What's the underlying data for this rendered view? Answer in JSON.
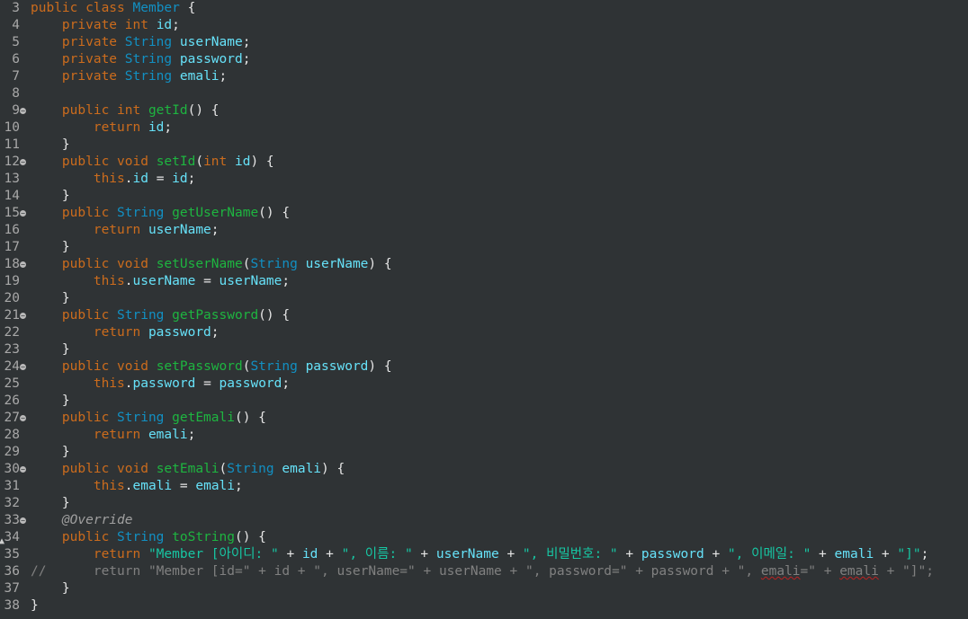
{
  "editor": {
    "lines": [
      {
        "n": "3",
        "fold": false,
        "toks": [
          [
            "kw",
            "public "
          ],
          [
            "kw",
            "class "
          ],
          [
            "type",
            "Member "
          ],
          [
            "txt",
            "{"
          ]
        ]
      },
      {
        "n": "4",
        "fold": false,
        "toks": [
          [
            "txt",
            "    "
          ],
          [
            "kw",
            "private "
          ],
          [
            "kw",
            "int "
          ],
          [
            "fld",
            "id"
          ],
          [
            "txt",
            ";"
          ]
        ]
      },
      {
        "n": "5",
        "fold": false,
        "toks": [
          [
            "txt",
            "    "
          ],
          [
            "kw",
            "private "
          ],
          [
            "type",
            "String "
          ],
          [
            "fld",
            "userName"
          ],
          [
            "txt",
            ";"
          ]
        ]
      },
      {
        "n": "6",
        "fold": false,
        "toks": [
          [
            "txt",
            "    "
          ],
          [
            "kw",
            "private "
          ],
          [
            "type",
            "String "
          ],
          [
            "fld",
            "password"
          ],
          [
            "txt",
            ";"
          ]
        ]
      },
      {
        "n": "7",
        "fold": false,
        "toks": [
          [
            "txt",
            "    "
          ],
          [
            "kw",
            "private "
          ],
          [
            "type",
            "String "
          ],
          [
            "fld",
            "emali"
          ],
          [
            "txt",
            ";"
          ]
        ]
      },
      {
        "n": "8",
        "fold": false,
        "toks": []
      },
      {
        "n": "9",
        "fold": true,
        "toks": [
          [
            "txt",
            "    "
          ],
          [
            "kw",
            "public "
          ],
          [
            "kw",
            "int "
          ],
          [
            "meth",
            "getId"
          ],
          [
            "txt",
            "() {"
          ]
        ]
      },
      {
        "n": "10",
        "fold": false,
        "toks": [
          [
            "txt",
            "        "
          ],
          [
            "kw",
            "return "
          ],
          [
            "fld",
            "id"
          ],
          [
            "txt",
            ";"
          ]
        ]
      },
      {
        "n": "11",
        "fold": false,
        "toks": [
          [
            "txt",
            "    }"
          ]
        ]
      },
      {
        "n": "12",
        "fold": true,
        "toks": [
          [
            "txt",
            "    "
          ],
          [
            "kw",
            "public "
          ],
          [
            "kw",
            "void "
          ],
          [
            "meth",
            "setId"
          ],
          [
            "txt",
            "("
          ],
          [
            "kw",
            "int "
          ],
          [
            "fld",
            "id"
          ],
          [
            "txt",
            ") {"
          ]
        ]
      },
      {
        "n": "13",
        "fold": false,
        "toks": [
          [
            "txt",
            "        "
          ],
          [
            "kw",
            "this"
          ],
          [
            "txt",
            "."
          ],
          [
            "fld",
            "id"
          ],
          [
            "txt",
            " = "
          ],
          [
            "fld",
            "id"
          ],
          [
            "txt",
            ";"
          ]
        ]
      },
      {
        "n": "14",
        "fold": false,
        "toks": [
          [
            "txt",
            "    }"
          ]
        ]
      },
      {
        "n": "15",
        "fold": true,
        "toks": [
          [
            "txt",
            "    "
          ],
          [
            "kw",
            "public "
          ],
          [
            "type",
            "String "
          ],
          [
            "meth",
            "getUserName"
          ],
          [
            "txt",
            "() {"
          ]
        ]
      },
      {
        "n": "16",
        "fold": false,
        "toks": [
          [
            "txt",
            "        "
          ],
          [
            "kw",
            "return "
          ],
          [
            "fld",
            "userName"
          ],
          [
            "txt",
            ";"
          ]
        ]
      },
      {
        "n": "17",
        "fold": false,
        "toks": [
          [
            "txt",
            "    }"
          ]
        ]
      },
      {
        "n": "18",
        "fold": true,
        "toks": [
          [
            "txt",
            "    "
          ],
          [
            "kw",
            "public "
          ],
          [
            "kw",
            "void "
          ],
          [
            "meth",
            "setUserName"
          ],
          [
            "txt",
            "("
          ],
          [
            "type",
            "String "
          ],
          [
            "fld",
            "userName"
          ],
          [
            "txt",
            ") {"
          ]
        ]
      },
      {
        "n": "19",
        "fold": false,
        "toks": [
          [
            "txt",
            "        "
          ],
          [
            "kw",
            "this"
          ],
          [
            "txt",
            "."
          ],
          [
            "fld",
            "userName"
          ],
          [
            "txt",
            " = "
          ],
          [
            "fld",
            "userName"
          ],
          [
            "txt",
            ";"
          ]
        ]
      },
      {
        "n": "20",
        "fold": false,
        "toks": [
          [
            "txt",
            "    }"
          ]
        ]
      },
      {
        "n": "21",
        "fold": true,
        "toks": [
          [
            "txt",
            "    "
          ],
          [
            "kw",
            "public "
          ],
          [
            "type",
            "String "
          ],
          [
            "meth",
            "getPassword"
          ],
          [
            "txt",
            "() {"
          ]
        ]
      },
      {
        "n": "22",
        "fold": false,
        "toks": [
          [
            "txt",
            "        "
          ],
          [
            "kw",
            "return "
          ],
          [
            "fld",
            "password"
          ],
          [
            "txt",
            ";"
          ]
        ]
      },
      {
        "n": "23",
        "fold": false,
        "toks": [
          [
            "txt",
            "    }"
          ]
        ]
      },
      {
        "n": "24",
        "fold": true,
        "toks": [
          [
            "txt",
            "    "
          ],
          [
            "kw",
            "public "
          ],
          [
            "kw",
            "void "
          ],
          [
            "meth",
            "setPassword"
          ],
          [
            "txt",
            "("
          ],
          [
            "type",
            "String "
          ],
          [
            "fld",
            "password"
          ],
          [
            "txt",
            ") {"
          ]
        ]
      },
      {
        "n": "25",
        "fold": false,
        "toks": [
          [
            "txt",
            "        "
          ],
          [
            "kw",
            "this"
          ],
          [
            "txt",
            "."
          ],
          [
            "fld",
            "password"
          ],
          [
            "txt",
            " = "
          ],
          [
            "fld",
            "password"
          ],
          [
            "txt",
            ";"
          ]
        ]
      },
      {
        "n": "26",
        "fold": false,
        "toks": [
          [
            "txt",
            "    }"
          ]
        ]
      },
      {
        "n": "27",
        "fold": true,
        "toks": [
          [
            "txt",
            "    "
          ],
          [
            "kw",
            "public "
          ],
          [
            "type",
            "String "
          ],
          [
            "meth",
            "getEmali"
          ],
          [
            "txt",
            "() {"
          ]
        ]
      },
      {
        "n": "28",
        "fold": false,
        "toks": [
          [
            "txt",
            "        "
          ],
          [
            "kw",
            "return "
          ],
          [
            "fld",
            "emali"
          ],
          [
            "txt",
            ";"
          ]
        ]
      },
      {
        "n": "29",
        "fold": false,
        "toks": [
          [
            "txt",
            "    }"
          ]
        ]
      },
      {
        "n": "30",
        "fold": true,
        "toks": [
          [
            "txt",
            "    "
          ],
          [
            "kw",
            "public "
          ],
          [
            "kw",
            "void "
          ],
          [
            "meth",
            "setEmali"
          ],
          [
            "txt",
            "("
          ],
          [
            "type",
            "String "
          ],
          [
            "fld",
            "emali"
          ],
          [
            "txt",
            ") {"
          ]
        ]
      },
      {
        "n": "31",
        "fold": false,
        "toks": [
          [
            "txt",
            "        "
          ],
          [
            "kw",
            "this"
          ],
          [
            "txt",
            "."
          ],
          [
            "fld",
            "emali"
          ],
          [
            "txt",
            " = "
          ],
          [
            "fld",
            "emali"
          ],
          [
            "txt",
            ";"
          ]
        ]
      },
      {
        "n": "32",
        "fold": false,
        "toks": [
          [
            "txt",
            "    }"
          ]
        ]
      },
      {
        "n": "33",
        "fold": true,
        "toks": [
          [
            "txt",
            "    "
          ],
          [
            "ann",
            "@Override"
          ]
        ]
      },
      {
        "n": "34",
        "fold": false,
        "marker": "▲",
        "toks": [
          [
            "txt",
            "    "
          ],
          [
            "kw",
            "public "
          ],
          [
            "type",
            "String "
          ],
          [
            "meth",
            "toString"
          ],
          [
            "txt",
            "() {"
          ]
        ]
      },
      {
        "n": "35",
        "fold": false,
        "toks": [
          [
            "txt",
            "        "
          ],
          [
            "kw",
            "return "
          ],
          [
            "str",
            "\"Member [아이디: \""
          ],
          [
            "txt",
            " + "
          ],
          [
            "fld",
            "id"
          ],
          [
            "txt",
            " + "
          ],
          [
            "str",
            "\", 이름: \""
          ],
          [
            "txt",
            " + "
          ],
          [
            "fld",
            "userName"
          ],
          [
            "txt",
            " + "
          ],
          [
            "str",
            "\", 비밀번호: \""
          ],
          [
            "txt",
            " + "
          ],
          [
            "fld",
            "password"
          ],
          [
            "txt",
            " + "
          ],
          [
            "str",
            "\", 이메일: \""
          ],
          [
            "txt",
            " + "
          ],
          [
            "fld",
            "emali"
          ],
          [
            "txt",
            " + "
          ],
          [
            "str",
            "\"]\""
          ],
          [
            "txt",
            ";"
          ]
        ]
      },
      {
        "n": "36",
        "fold": false,
        "toks": [
          [
            "cm",
            "//      return \"Member [id=\" + id + \", userName=\" + userName + \", password=\" + password + \", "
          ],
          [
            "cm sq",
            "emali"
          ],
          [
            "cm",
            "=\" + "
          ],
          [
            "cm sq",
            "emali"
          ],
          [
            "cm",
            " + \"]\";"
          ]
        ]
      },
      {
        "n": "37",
        "fold": false,
        "toks": [
          [
            "txt",
            "    }"
          ]
        ]
      },
      {
        "n": "38",
        "fold": false,
        "toks": [
          [
            "txt",
            "}"
          ]
        ]
      }
    ]
  }
}
